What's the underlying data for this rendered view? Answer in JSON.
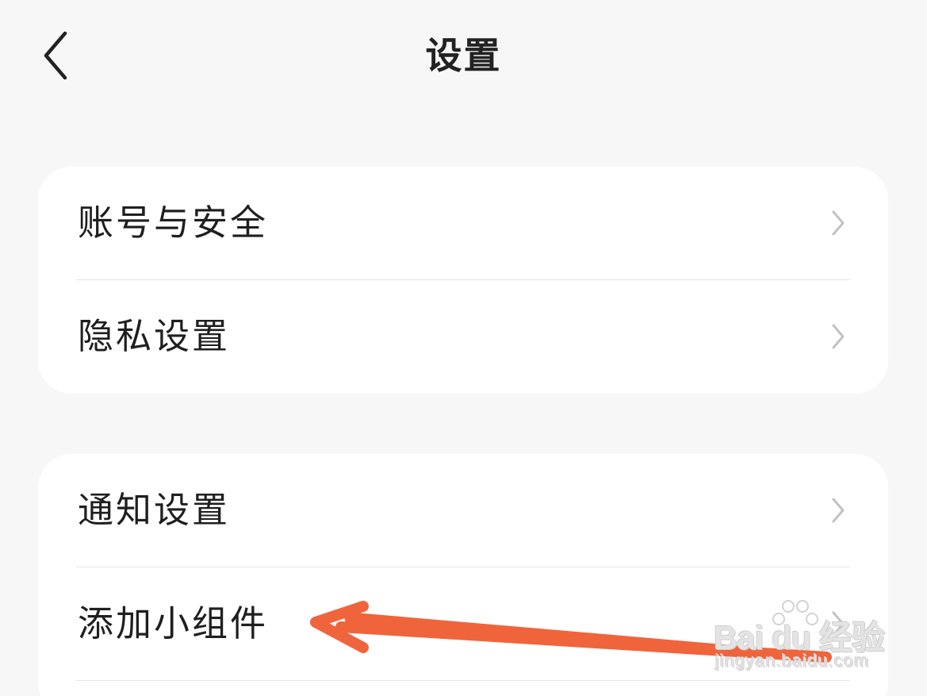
{
  "header": {
    "title": "设置",
    "back_icon": "chevron-left-icon"
  },
  "groups": [
    {
      "items": [
        {
          "label": "账号与安全",
          "icon": "chevron-right-icon"
        },
        {
          "label": "隐私设置",
          "icon": "chevron-right-icon"
        }
      ]
    },
    {
      "items": [
        {
          "label": "通知设置",
          "icon": "chevron-right-icon"
        },
        {
          "label": "添加小组件",
          "icon": "chevron-right-icon"
        }
      ]
    }
  ],
  "annotation": {
    "type": "red-arrow",
    "color": "#f0643c",
    "points_to": "添加小组件"
  },
  "watermark": {
    "brand": "Bai du 经验",
    "site": "jingyan.baidu.com"
  },
  "colors": {
    "background": "#f7f7f7",
    "card": "#ffffff",
    "text": "#1f1f1f",
    "chevron": "#c2c2c2",
    "divider": "#e6e6e6",
    "arrow": "#f0643c"
  }
}
